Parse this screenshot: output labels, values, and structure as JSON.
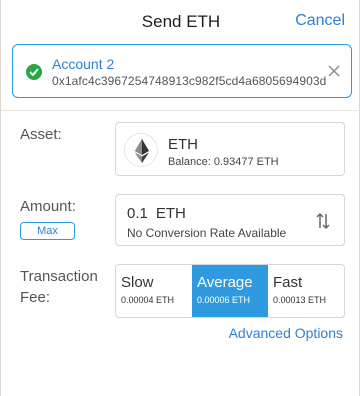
{
  "header": {
    "title": "Send ETH",
    "cancel_label": "Cancel"
  },
  "account": {
    "name": "Account 2",
    "address": "0x1afc4c3967254748913c982f5cd4a6805694903d"
  },
  "asset": {
    "label": "Asset:",
    "symbol": "ETH",
    "balance_label": "Balance:",
    "balance_value": "0.93477 ETH"
  },
  "amount": {
    "label": "Amount:",
    "value": "0.1",
    "unit": "ETH",
    "conversion": "No Conversion Rate Available",
    "max_label": "Max"
  },
  "fee": {
    "label_line1": "Transaction",
    "label_line2": "Fee:",
    "options": [
      {
        "name": "Slow",
        "value": "0.00004 ETH",
        "selected": false
      },
      {
        "name": "Average",
        "value": "0.00006 ETH",
        "selected": true
      },
      {
        "name": "Fast",
        "value": "0.00013 ETH",
        "selected": false
      }
    ]
  },
  "advanced_label": "Advanced Options",
  "colors": {
    "accent": "#2f9ae0",
    "link": "#2f80d1",
    "success": "#28a745"
  }
}
